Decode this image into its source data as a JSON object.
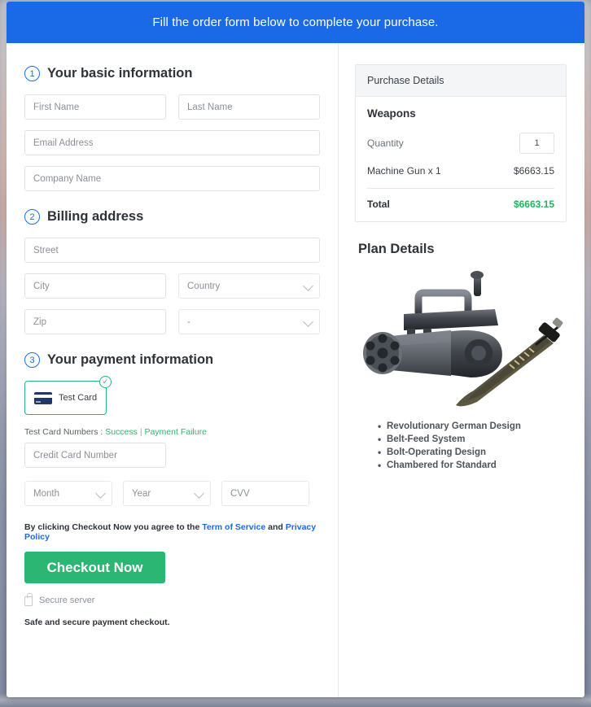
{
  "banner": {
    "message": "Fill the order form below to complete your purchase."
  },
  "steps": [
    {
      "number": "1",
      "title": "Your basic information"
    },
    {
      "number": "2",
      "title": "Billing address"
    },
    {
      "number": "3",
      "title": "Your payment information"
    }
  ],
  "basic_info": {
    "first_name_placeholder": "First Name",
    "last_name_placeholder": "Last Name",
    "email_placeholder": "Email Address",
    "company_placeholder": "Company Name",
    "first_name_value": "",
    "last_name_value": "",
    "email_value": "",
    "company_value": ""
  },
  "billing": {
    "street_placeholder": "Street",
    "city_placeholder": "City",
    "zip_placeholder": "Zip",
    "country_selected": "Country",
    "state_selected": "-",
    "street_value": "",
    "city_value": "",
    "zip_value": ""
  },
  "payment": {
    "test_card_label": "Test  Card",
    "test_numbers_prefix": "Test Card Numbers :",
    "success_link": "Success",
    "separator": "|",
    "failure_link": "Payment Failure",
    "card_number_placeholder": "Credit Card Number",
    "card_number_value": "",
    "month_selected": "Month",
    "year_selected": "Year",
    "cvv_placeholder": "CVV",
    "cvv_value": ""
  },
  "terms": {
    "prefix": "By clicking Checkout Now you agree to the",
    "tos_link": "Term of Service",
    "and": "and",
    "privacy_link": "Privacy Policy"
  },
  "actions": {
    "checkout_label": "Checkout Now",
    "secure_server_text": "Secure server",
    "safe_note": "Safe and secure payment checkout."
  },
  "purchase": {
    "header": "Purchase Details",
    "group_title": "Weapons",
    "quantity_label": "Quantity",
    "quantity_value": "1",
    "item_name": "Machine Gun x 1",
    "item_price": "$6663.15",
    "total_label": "Total",
    "total_value": "$6663.15"
  },
  "plan": {
    "title": "Plan Details",
    "features": [
      "Revolutionary German Design",
      "Belt-Feed System",
      "Bolt-Operating Design",
      "Chambered for Standard"
    ]
  },
  "colors": {
    "banner_blue": "#1a6ae8",
    "accent_green": "#2bb673",
    "total_green": "#22b45f",
    "link_blue": "#1a6ae8"
  }
}
